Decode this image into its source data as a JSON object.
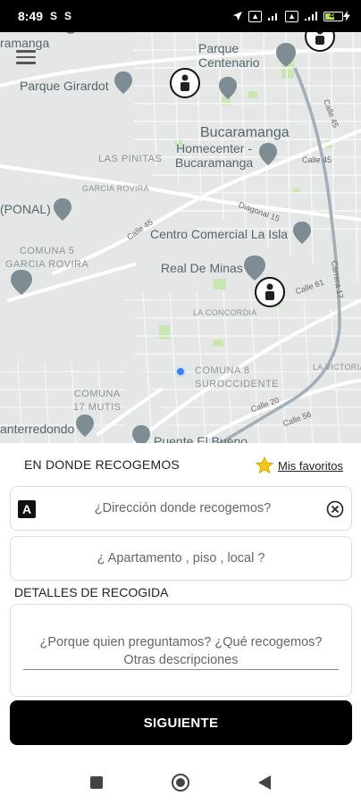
{
  "status_bar": {
    "time": "8:49",
    "left_icons": [
      "S",
      "S"
    ],
    "battery_level": "46"
  },
  "map": {
    "labels": {
      "ramanga": "ramanga",
      "parque_centenario": "Parque\nCentenario",
      "parque_girardot": "Parque Girardot",
      "bucaramanga": "Bucaramanga",
      "homecenter": "Homecenter -\nBucaramanga",
      "las_pinitas": "LAS PINITAS",
      "garcia_rovira": "GARCIA ROVIRA",
      "ponal": "(PONAL)",
      "centro_comercial": "Centro Comercial La Isla",
      "comuna_5": "COMUNA 5\nGARCIA ROVIRA",
      "real_de_minas": "Real De Minas",
      "la_concordia": "LA CONCORDIA",
      "comuna_8": "COMUNA 8\nSUROCCIDENTE",
      "comuna_17": "COMUNA\n17 MUTIS",
      "la_victoria": "LA VICTORIA",
      "anterredondo": "anterredondo",
      "puente_el_bueno": "Puente El Bueno",
      "calle_45_a": "Calle 45",
      "calle_45_b": "Calle 45",
      "calle_61": "Calle 61",
      "calle_56": "Calle 56",
      "diagonal_15": "Diagonal 15",
      "carrera_17": "Carrera 17",
      "calle_45_c": "Calle 45",
      "calle_20": "Calle 20"
    }
  },
  "form": {
    "pickup_title": "EN DONDE RECOGEMOS",
    "favorites_label": "Mis favoritos",
    "address_placeholder": "¿Dirección donde recogemos?",
    "address_icon_letter": "A",
    "apartment_placeholder": "¿ Apartamento , piso  , local ?",
    "details_title": "DETALLES DE RECOGIDA",
    "details_placeholder_line1": "¿Porque quien preguntamos? ¿Qué recogemos?",
    "details_placeholder_line2": "Otras descripciones",
    "next_button_label": "SIGUIENTE"
  },
  "colors": {
    "accent": "#000000",
    "star": "#f5c518",
    "map_bg": "#e5e7e6",
    "user_location": "#3b82f6"
  },
  "icons": {
    "menu": "hamburger-icon",
    "star": "star-icon",
    "clear": "close-circle-icon",
    "address": "letter-a-icon",
    "nav_recents": "square-icon",
    "nav_home": "circle-icon",
    "nav_back": "triangle-back-icon"
  }
}
